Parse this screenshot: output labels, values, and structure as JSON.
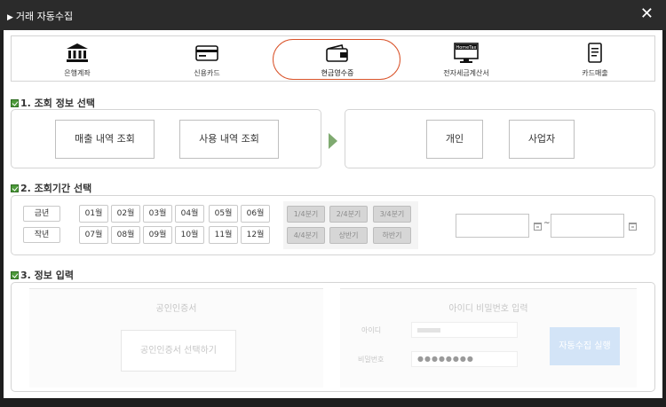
{
  "window": {
    "title": "거래 자동수집",
    "close_label": "✕"
  },
  "tabs": [
    {
      "label": "은행계좌",
      "icon": "bank-icon",
      "active": false
    },
    {
      "label": "신용카드",
      "icon": "credit-card-icon",
      "active": false
    },
    {
      "label": "현금영수증",
      "icon": "wallet-icon",
      "active": true
    },
    {
      "label": "전자세금계산서",
      "icon": "hometax-monitor-icon",
      "active": false
    },
    {
      "label": "카드매출",
      "icon": "document-icon",
      "active": false
    }
  ],
  "hometax_screen_text": "HomeTax",
  "section1": {
    "title": "1. 조회 정보 선택",
    "buttons": [
      "매출 내역 조회",
      "사용 내역 조회"
    ],
    "who": [
      "개인",
      "사업자"
    ]
  },
  "section2": {
    "title": "2. 조회기간 선택",
    "years": [
      "금년",
      "작년"
    ],
    "months_row1": [
      "01월",
      "02월",
      "03월",
      "04월",
      "05월",
      "06월"
    ],
    "months_row2": [
      "07월",
      "08월",
      "09월",
      "10월",
      "11월",
      "12월"
    ],
    "quarters_row1": [
      "1/4분기",
      "2/4분기",
      "3/4분기"
    ],
    "quarters_row2": [
      "4/4분기",
      "상반기",
      "하반기"
    ],
    "range_sep": "~"
  },
  "section3": {
    "title": "3. 정보 입력",
    "cert_title": "공인인증서",
    "cert_button": "공인인증서 선택하기",
    "login_title": "아이디 비밀번호 입력",
    "id_label": "아이디",
    "pw_label": "비밀번호",
    "pw_value": "●●●●●●●●",
    "run_button": "자동수집 실행"
  },
  "colors": {
    "active_tab_border": "#d9532a",
    "run_button": "#d3e4f7",
    "disabled_quarter": "#d6d6d6"
  }
}
